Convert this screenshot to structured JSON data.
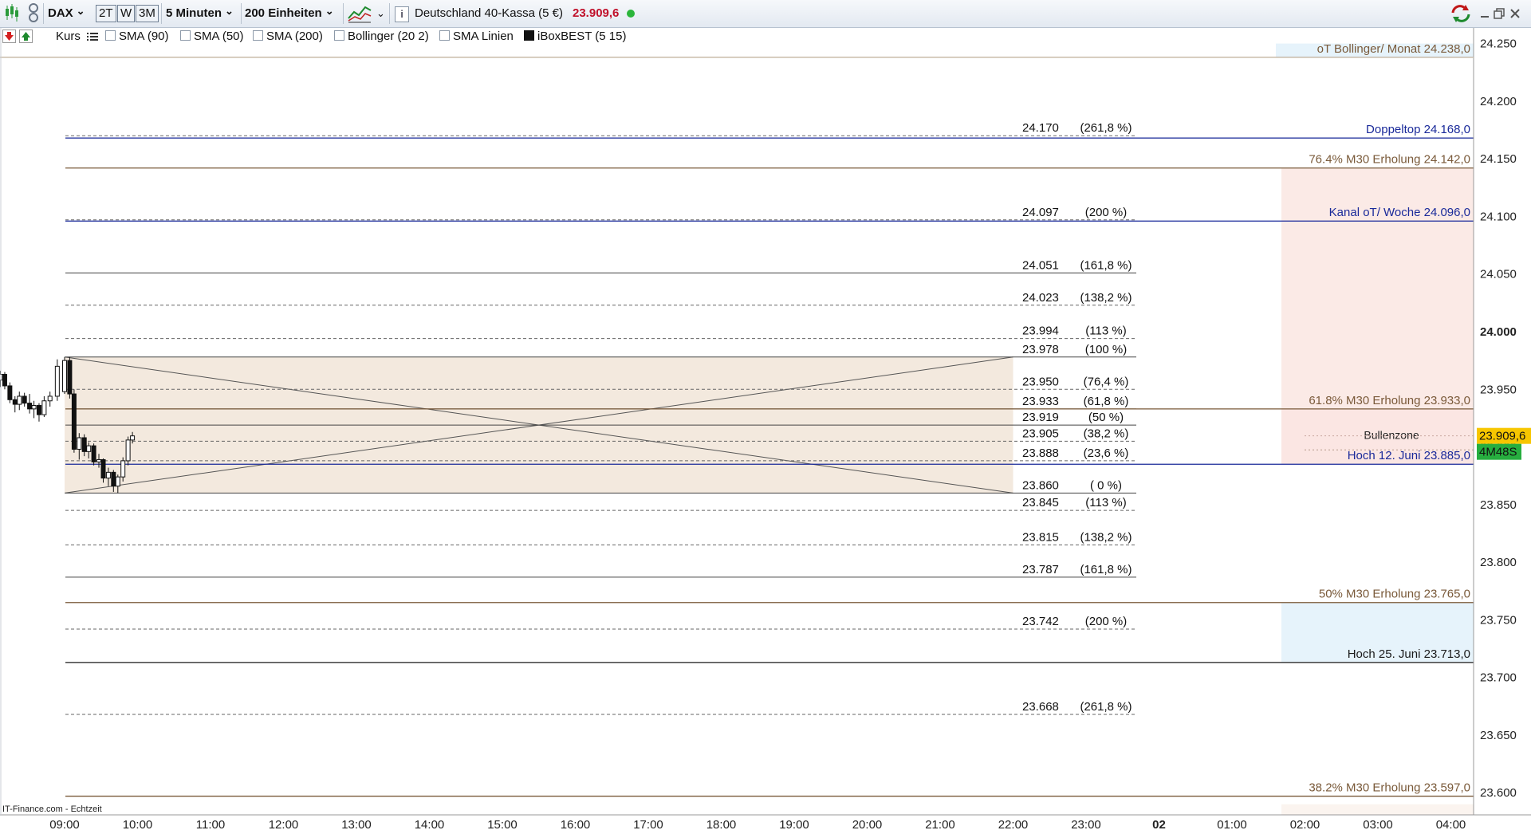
{
  "toolbar": {
    "symbol": "DAX",
    "range_buttons": [
      "2T",
      "W",
      "3M"
    ],
    "interval": "5 Minuten",
    "units": "200 Einheiten",
    "instrument": "Deutschland 40-Kassa (5 €)",
    "last_price": "23.909,6",
    "info_icon": "info-icon",
    "live_status_color": "#2ab53a"
  },
  "indicators": [
    {
      "label": "Kurs",
      "checked": null
    },
    {
      "label": "SMA (90)",
      "checked": false
    },
    {
      "label": "SMA (50)",
      "checked": false
    },
    {
      "label": "SMA (200)",
      "checked": false
    },
    {
      "label": "Bollinger (20 2)",
      "checked": false
    },
    {
      "label": "SMA Linien",
      "checked": false
    },
    {
      "label": "iBoxBEST (5 15)",
      "checked": true
    }
  ],
  "chart_data": {
    "type": "candlestick",
    "instrument": "DAX",
    "interval": "5 Minuten",
    "source_note": "IT-Finance.com - Echtzeit",
    "y_axis": {
      "ticks": [
        "24.250",
        "24.200",
        "24.150",
        "24.100",
        "24.050",
        "24.000",
        "23.950",
        "23.900",
        "23.850",
        "23.800",
        "23.750",
        "23.700",
        "23.650",
        "23.600"
      ],
      "tick_values": [
        24250,
        24200,
        24150,
        24100,
        24050,
        24000,
        23950,
        23900,
        23850,
        23800,
        23750,
        23700,
        23650,
        23600
      ],
      "bold_tick": "24.000",
      "ylim": [
        23578,
        24286
      ]
    },
    "x_axis": {
      "ticks": [
        "09:00",
        "10:00",
        "11:00",
        "12:00",
        "13:00",
        "14:00",
        "15:00",
        "16:00",
        "17:00",
        "18:00",
        "19:00",
        "20:00",
        "21:00",
        "22:00",
        "23:00",
        "02",
        "01:00",
        "02:00",
        "03:00",
        "04:00"
      ],
      "bold_tick": "02",
      "tick_hours": [
        9,
        10,
        11,
        12,
        13,
        14,
        15,
        16,
        17,
        18,
        19,
        20,
        21,
        22,
        23,
        24,
        25,
        26,
        27,
        28
      ]
    },
    "current_price": {
      "label": "23.909,6",
      "value": 23909.6,
      "color": "#f7c600"
    },
    "countdown": {
      "label": "4M48S",
      "color": "#27ae3f"
    },
    "candles": [
      {
        "t": 8.05,
        "o": 23962,
        "h": 23965,
        "l": 23955,
        "c": 23958
      },
      {
        "t": 8.12,
        "o": 23958,
        "h": 23966,
        "l": 23952,
        "c": 23963
      },
      {
        "t": 8.18,
        "o": 23963,
        "h": 23965,
        "l": 23950,
        "c": 23953
      },
      {
        "t": 8.25,
        "o": 23953,
        "h": 23956,
        "l": 23938,
        "c": 23941
      },
      {
        "t": 8.32,
        "o": 23941,
        "h": 23944,
        "l": 23930,
        "c": 23937
      },
      {
        "t": 8.38,
        "o": 23937,
        "h": 23948,
        "l": 23932,
        "c": 23944
      },
      {
        "t": 8.45,
        "o": 23944,
        "h": 23947,
        "l": 23935,
        "c": 23938
      },
      {
        "t": 8.52,
        "o": 23938,
        "h": 23946,
        "l": 23929,
        "c": 23933
      },
      {
        "t": 8.58,
        "o": 23933,
        "h": 23940,
        "l": 23925,
        "c": 23936
      },
      {
        "t": 8.65,
        "o": 23936,
        "h": 23938,
        "l": 23922,
        "c": 23928
      },
      {
        "t": 8.72,
        "o": 23928,
        "h": 23944,
        "l": 23926,
        "c": 23940
      },
      {
        "t": 8.8,
        "o": 23940,
        "h": 23948,
        "l": 23935,
        "c": 23944
      },
      {
        "t": 8.9,
        "o": 23944,
        "h": 23976,
        "l": 23940,
        "c": 23970
      },
      {
        "t": 9.0,
        "o": 23948,
        "h": 23978,
        "l": 23946,
        "c": 23975
      },
      {
        "t": 9.07,
        "o": 23975,
        "h": 23978,
        "l": 23942,
        "c": 23946
      },
      {
        "t": 9.13,
        "o": 23946,
        "h": 23950,
        "l": 23895,
        "c": 23898
      },
      {
        "t": 9.2,
        "o": 23898,
        "h": 23912,
        "l": 23889,
        "c": 23908
      },
      {
        "t": 9.27,
        "o": 23908,
        "h": 23911,
        "l": 23892,
        "c": 23896
      },
      {
        "t": 9.33,
        "o": 23896,
        "h": 23904,
        "l": 23890,
        "c": 23901
      },
      {
        "t": 9.4,
        "o": 23901,
        "h": 23903,
        "l": 23884,
        "c": 23887
      },
      {
        "t": 9.47,
        "o": 23887,
        "h": 23894,
        "l": 23882,
        "c": 23889
      },
      {
        "t": 9.53,
        "o": 23889,
        "h": 23890,
        "l": 23869,
        "c": 23873
      },
      {
        "t": 9.6,
        "o": 23873,
        "h": 23882,
        "l": 23866,
        "c": 23878
      },
      {
        "t": 9.67,
        "o": 23878,
        "h": 23880,
        "l": 23861,
        "c": 23866
      },
      {
        "t": 9.73,
        "o": 23866,
        "h": 23876,
        "l": 23860,
        "c": 23874
      },
      {
        "t": 9.8,
        "o": 23874,
        "h": 23891,
        "l": 23870,
        "c": 23888
      },
      {
        "t": 9.87,
        "o": 23888,
        "h": 23909,
        "l": 23884,
        "c": 23906
      },
      {
        "t": 9.93,
        "o": 23906,
        "h": 23913,
        "l": 23903,
        "c": 23909.6
      }
    ],
    "box": {
      "t_start": 9.0,
      "t_end": 22.0,
      "top": 23978,
      "bottom": 23860,
      "fill": "#f3e9de"
    },
    "fib_levels": [
      {
        "value": 24170,
        "label": "24.170",
        "pct": "(261,8 %)",
        "style": "dashed"
      },
      {
        "value": 24097,
        "label": "24.097",
        "pct": "(200 %)",
        "style": "dashed"
      },
      {
        "value": 24051,
        "label": "24.051",
        "pct": "(161,8 %)",
        "style": "solid"
      },
      {
        "value": 24023,
        "label": "24.023",
        "pct": "(138,2 %)",
        "style": "dashed"
      },
      {
        "value": 23994,
        "label": "23.994",
        "pct": "(113 %)",
        "style": "dashed"
      },
      {
        "value": 23978,
        "label": "23.978",
        "pct": "(100 %)",
        "style": "solid"
      },
      {
        "value": 23950,
        "label": "23.950",
        "pct": "(76,4 %)",
        "style": "dashed"
      },
      {
        "value": 23933,
        "label": "23.933",
        "pct": "(61,8 %)",
        "style": "solid"
      },
      {
        "value": 23919,
        "label": "23.919",
        "pct": "(50 %)",
        "style": "solid"
      },
      {
        "value": 23905,
        "label": "23.905",
        "pct": "(38,2 %)",
        "style": "dashed"
      },
      {
        "value": 23888,
        "label": "23.888",
        "pct": "(23,6 %)",
        "style": "dashed"
      },
      {
        "value": 23860,
        "label": "23.860",
        "pct": "( 0 %)",
        "style": "solid"
      },
      {
        "value": 23845,
        "label": "23.845",
        "pct": "(113 %)",
        "style": "dashed"
      },
      {
        "value": 23815,
        "label": "23.815",
        "pct": "(138,2 %)",
        "style": "dashed"
      },
      {
        "value": 23787,
        "label": "23.787",
        "pct": "(161,8 %)",
        "style": "solid"
      },
      {
        "value": 23742,
        "label": "23.742",
        "pct": "(200 %)",
        "style": "dashed"
      },
      {
        "value": 23668,
        "label": "23.668",
        "pct": "(261,8 %)",
        "style": "dashed"
      }
    ],
    "annotation_lines": [
      {
        "value": 24238,
        "label": "oT Bollinger/ Monat 24.238,0",
        "color": "#7a5a3a"
      },
      {
        "value": 24168,
        "label": "Doppeltop 24.168,0",
        "color": "#1a2a9a"
      },
      {
        "value": 24142,
        "label": "76.4%  M30 Erholung 24.142,0",
        "color": "#7a5a3a"
      },
      {
        "value": 24096,
        "label": "Kanal oT/ Woche 24.096,0",
        "color": "#1a2a9a"
      },
      {
        "value": 23933,
        "label": "61.8%  M30 Erholung 23.933,0",
        "color": "#7a5a3a"
      },
      {
        "value": 23885,
        "label": "Hoch 12. Juni 23.885,0",
        "color": "#1a2a9a"
      },
      {
        "value": 23765,
        "label": "50%  M30 Erholung 23.765,0",
        "color": "#7a5a3a"
      },
      {
        "value": 23713,
        "label": "Hoch 25. Juni 23.713,0",
        "color": "#1a1a1a"
      },
      {
        "value": 23597,
        "label": "38.2%  M30 Erholung 23.597,0",
        "color": "#7a5a3a"
      }
    ],
    "zones": [
      {
        "label": "",
        "top": 24250,
        "bottom": 24238,
        "fill": "#e6f3fb"
      },
      {
        "label": "",
        "top": 24142,
        "bottom": 23933,
        "fill": "#fbeae6"
      },
      {
        "label": "Bullenzone",
        "top": 23933,
        "bottom": 23885,
        "fill": "#fbe6e3"
      },
      {
        "label": "",
        "top": 23765,
        "bottom": 23713,
        "fill": "#e6f3fb"
      }
    ]
  }
}
